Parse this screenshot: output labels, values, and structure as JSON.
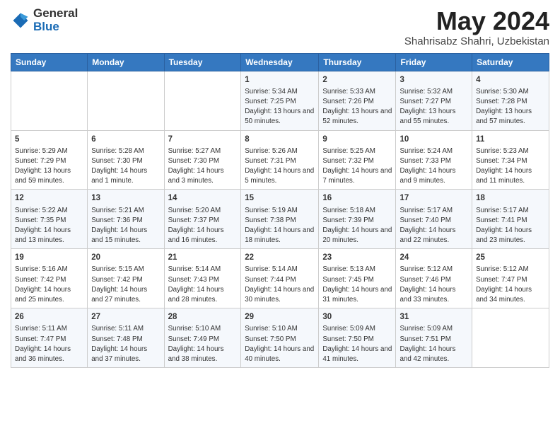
{
  "logo": {
    "general": "General",
    "blue": "Blue"
  },
  "title": "May 2024",
  "subtitle": "Shahrisabz Shahri, Uzbekistan",
  "days_of_week": [
    "Sunday",
    "Monday",
    "Tuesday",
    "Wednesday",
    "Thursday",
    "Friday",
    "Saturday"
  ],
  "weeks": [
    [
      {
        "num": "",
        "info": ""
      },
      {
        "num": "",
        "info": ""
      },
      {
        "num": "",
        "info": ""
      },
      {
        "num": "1",
        "info": "Sunrise: 5:34 AM\nSunset: 7:25 PM\nDaylight: 13 hours and 50 minutes."
      },
      {
        "num": "2",
        "info": "Sunrise: 5:33 AM\nSunset: 7:26 PM\nDaylight: 13 hours and 52 minutes."
      },
      {
        "num": "3",
        "info": "Sunrise: 5:32 AM\nSunset: 7:27 PM\nDaylight: 13 hours and 55 minutes."
      },
      {
        "num": "4",
        "info": "Sunrise: 5:30 AM\nSunset: 7:28 PM\nDaylight: 13 hours and 57 minutes."
      }
    ],
    [
      {
        "num": "5",
        "info": "Sunrise: 5:29 AM\nSunset: 7:29 PM\nDaylight: 13 hours and 59 minutes."
      },
      {
        "num": "6",
        "info": "Sunrise: 5:28 AM\nSunset: 7:30 PM\nDaylight: 14 hours and 1 minute."
      },
      {
        "num": "7",
        "info": "Sunrise: 5:27 AM\nSunset: 7:30 PM\nDaylight: 14 hours and 3 minutes."
      },
      {
        "num": "8",
        "info": "Sunrise: 5:26 AM\nSunset: 7:31 PM\nDaylight: 14 hours and 5 minutes."
      },
      {
        "num": "9",
        "info": "Sunrise: 5:25 AM\nSunset: 7:32 PM\nDaylight: 14 hours and 7 minutes."
      },
      {
        "num": "10",
        "info": "Sunrise: 5:24 AM\nSunset: 7:33 PM\nDaylight: 14 hours and 9 minutes."
      },
      {
        "num": "11",
        "info": "Sunrise: 5:23 AM\nSunset: 7:34 PM\nDaylight: 14 hours and 11 minutes."
      }
    ],
    [
      {
        "num": "12",
        "info": "Sunrise: 5:22 AM\nSunset: 7:35 PM\nDaylight: 14 hours and 13 minutes."
      },
      {
        "num": "13",
        "info": "Sunrise: 5:21 AM\nSunset: 7:36 PM\nDaylight: 14 hours and 15 minutes."
      },
      {
        "num": "14",
        "info": "Sunrise: 5:20 AM\nSunset: 7:37 PM\nDaylight: 14 hours and 16 minutes."
      },
      {
        "num": "15",
        "info": "Sunrise: 5:19 AM\nSunset: 7:38 PM\nDaylight: 14 hours and 18 minutes."
      },
      {
        "num": "16",
        "info": "Sunrise: 5:18 AM\nSunset: 7:39 PM\nDaylight: 14 hours and 20 minutes."
      },
      {
        "num": "17",
        "info": "Sunrise: 5:17 AM\nSunset: 7:40 PM\nDaylight: 14 hours and 22 minutes."
      },
      {
        "num": "18",
        "info": "Sunrise: 5:17 AM\nSunset: 7:41 PM\nDaylight: 14 hours and 23 minutes."
      }
    ],
    [
      {
        "num": "19",
        "info": "Sunrise: 5:16 AM\nSunset: 7:42 PM\nDaylight: 14 hours and 25 minutes."
      },
      {
        "num": "20",
        "info": "Sunrise: 5:15 AM\nSunset: 7:42 PM\nDaylight: 14 hours and 27 minutes."
      },
      {
        "num": "21",
        "info": "Sunrise: 5:14 AM\nSunset: 7:43 PM\nDaylight: 14 hours and 28 minutes."
      },
      {
        "num": "22",
        "info": "Sunrise: 5:14 AM\nSunset: 7:44 PM\nDaylight: 14 hours and 30 minutes."
      },
      {
        "num": "23",
        "info": "Sunrise: 5:13 AM\nSunset: 7:45 PM\nDaylight: 14 hours and 31 minutes."
      },
      {
        "num": "24",
        "info": "Sunrise: 5:12 AM\nSunset: 7:46 PM\nDaylight: 14 hours and 33 minutes."
      },
      {
        "num": "25",
        "info": "Sunrise: 5:12 AM\nSunset: 7:47 PM\nDaylight: 14 hours and 34 minutes."
      }
    ],
    [
      {
        "num": "26",
        "info": "Sunrise: 5:11 AM\nSunset: 7:47 PM\nDaylight: 14 hours and 36 minutes."
      },
      {
        "num": "27",
        "info": "Sunrise: 5:11 AM\nSunset: 7:48 PM\nDaylight: 14 hours and 37 minutes."
      },
      {
        "num": "28",
        "info": "Sunrise: 5:10 AM\nSunset: 7:49 PM\nDaylight: 14 hours and 38 minutes."
      },
      {
        "num": "29",
        "info": "Sunrise: 5:10 AM\nSunset: 7:50 PM\nDaylight: 14 hours and 40 minutes."
      },
      {
        "num": "30",
        "info": "Sunrise: 5:09 AM\nSunset: 7:50 PM\nDaylight: 14 hours and 41 minutes."
      },
      {
        "num": "31",
        "info": "Sunrise: 5:09 AM\nSunset: 7:51 PM\nDaylight: 14 hours and 42 minutes."
      },
      {
        "num": "",
        "info": ""
      }
    ]
  ]
}
